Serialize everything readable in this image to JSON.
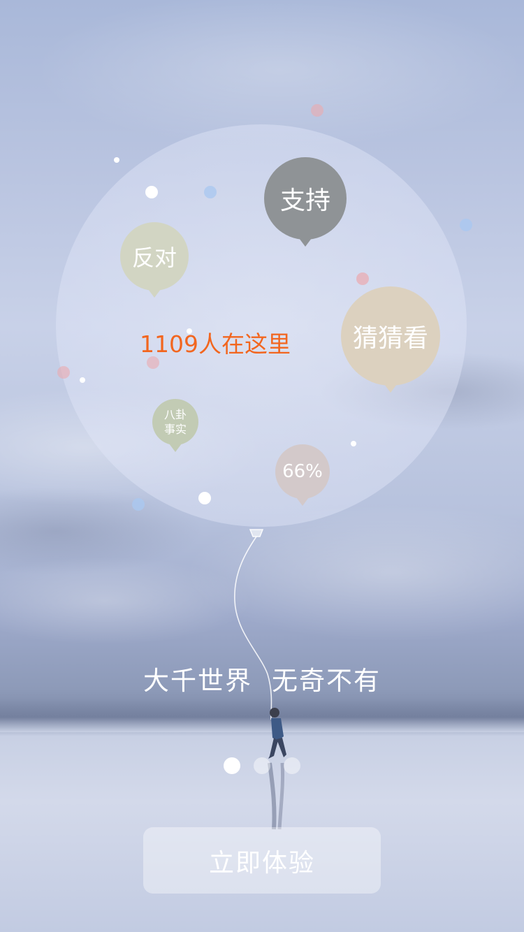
{
  "balloon": {
    "people_count": "1109人在这里",
    "bubbles": {
      "support": "支持",
      "oppose": "反对",
      "guess": "猜猜看",
      "gossip_line1": "八卦",
      "gossip_line2": "事实",
      "percent": "66%"
    },
    "colors": {
      "people_count": "#f2661f",
      "support": "#8f9396",
      "oppose": "#d2d5c3",
      "guess": "#dcd1bf",
      "gossip": "#c2cbb4",
      "percent": "#d3c9ca"
    }
  },
  "slogan": {
    "part1": "大千世界",
    "part2": "无奇不有"
  },
  "pager": {
    "total": 3,
    "active_index": 0
  },
  "cta": {
    "label": "立即体验"
  }
}
